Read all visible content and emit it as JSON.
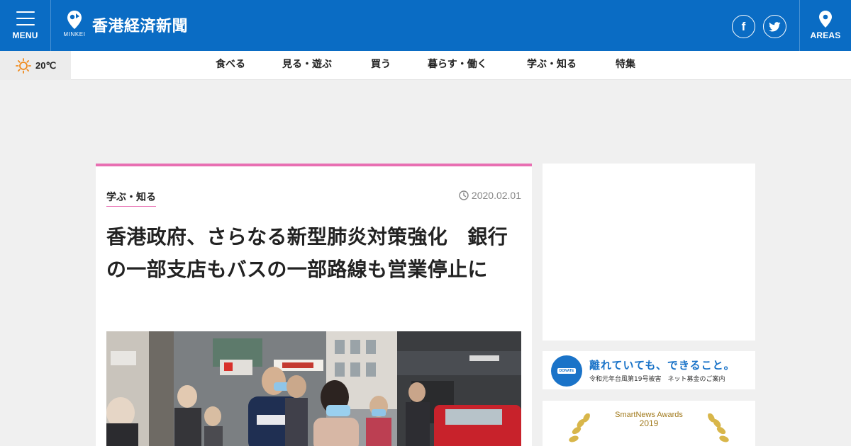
{
  "header": {
    "menu_label": "MENU",
    "logo_sub": "MINKEI",
    "site_title": "香港経済新聞",
    "facebook_glyph": "f",
    "areas_label": "AREAS",
    "brand_color": "#0a6cc4"
  },
  "weather": {
    "icon": "sun-icon",
    "temperature": "20℃"
  },
  "nav": {
    "items": [
      {
        "label": "食べる"
      },
      {
        "label": "見る・遊ぶ"
      },
      {
        "label": "買う"
      },
      {
        "label": "暮らす・働く"
      },
      {
        "label": "学ぶ・知る"
      },
      {
        "label": "特集"
      }
    ]
  },
  "article": {
    "category": "学ぶ・知る",
    "date": "2020.02.01",
    "title": "香港政府、さらなる新型肺炎対策強化　銀行の一部支店もバスの一部路線も営業停止に",
    "accent_color": "#e86fb2"
  },
  "sidebar": {
    "donate": {
      "badge": "DONATE",
      "title": "離れていても、できること。",
      "subtitle": "令和元年台風第19号被害　ネット募金のご案内"
    },
    "awards": {
      "title": "SmartNews Awards",
      "year": "2019"
    }
  }
}
